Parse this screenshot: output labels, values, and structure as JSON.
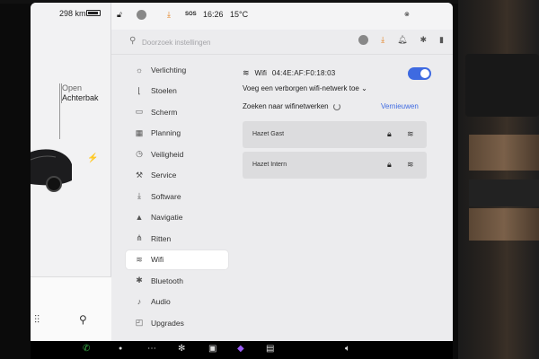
{
  "status": {
    "range": "298 km",
    "time": "16:26",
    "temperature": "15°C",
    "sos": "SOS"
  },
  "car_panel": {
    "trunk_line1": "Open",
    "trunk_line2": "Achterbak"
  },
  "search": {
    "placeholder": "Doorzoek instellingen"
  },
  "nav": {
    "items": [
      {
        "label": "Verlichting",
        "icon": "sun-icon"
      },
      {
        "label": "Stoelen",
        "icon": "seat-icon"
      },
      {
        "label": "Scherm",
        "icon": "display-icon"
      },
      {
        "label": "Planning",
        "icon": "calendar-icon"
      },
      {
        "label": "Veiligheid",
        "icon": "safety-icon"
      },
      {
        "label": "Service",
        "icon": "wrench-icon"
      },
      {
        "label": "Software",
        "icon": "download-icon"
      },
      {
        "label": "Navigatie",
        "icon": "navigation-icon"
      },
      {
        "label": "Ritten",
        "icon": "trips-icon"
      },
      {
        "label": "Wifi",
        "icon": "wifi-icon"
      },
      {
        "label": "Bluetooth",
        "icon": "bluetooth-icon"
      },
      {
        "label": "Audio",
        "icon": "music-icon"
      },
      {
        "label": "Upgrades",
        "icon": "bag-icon"
      }
    ],
    "active": "Wifi"
  },
  "wifi": {
    "label": "Wifi",
    "mac": "04:4E:AF:F0:18:03",
    "enabled": true,
    "hidden_network": "Voeg een verborgen wifi-netwerk toe",
    "scanning": "Zoeken naar wifinetwerken",
    "refresh": "Vernieuwen",
    "networks": [
      {
        "name": "Hazet Gast"
      },
      {
        "name": "Hazet Intern"
      }
    ]
  },
  "colors": {
    "accent": "#3e6ae1",
    "warning": "#e37b16"
  }
}
